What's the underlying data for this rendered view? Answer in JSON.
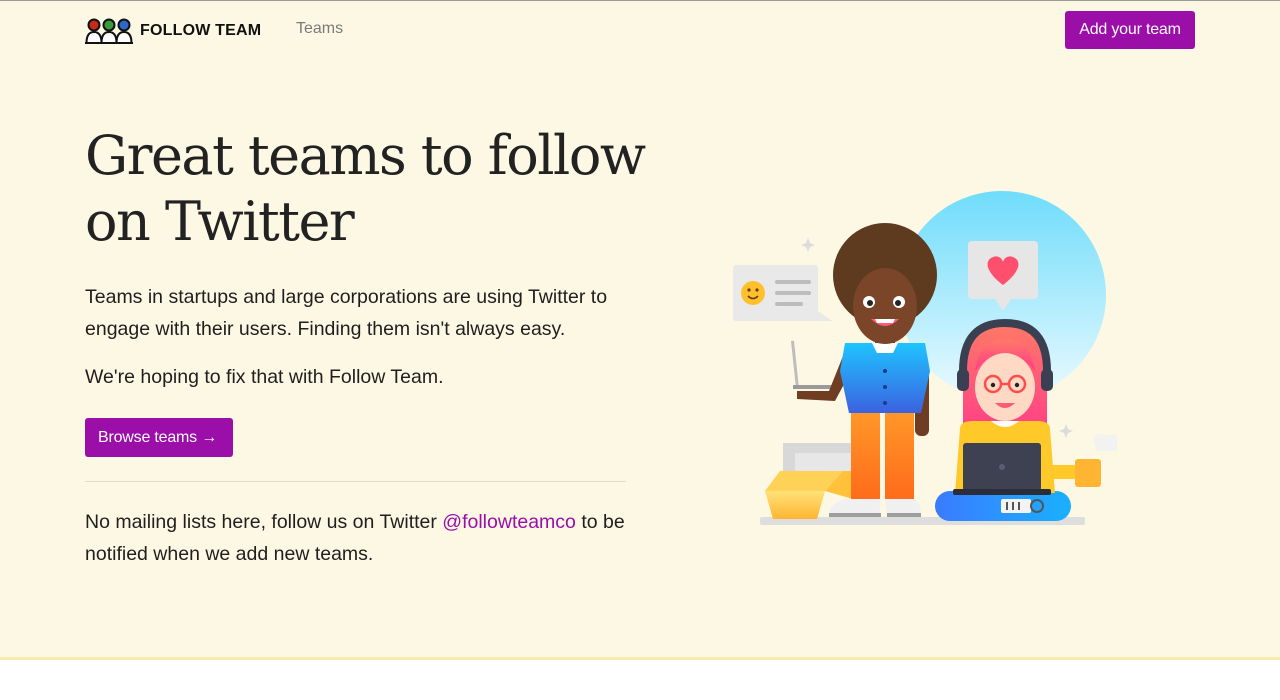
{
  "header": {
    "logo_text": "FOLLOW TEAM",
    "nav": [
      {
        "label": "Teams"
      }
    ],
    "cta_label": "Add your team"
  },
  "hero": {
    "title_line1": "Great teams to follow",
    "title_line2": "on Twitter",
    "lead": "Teams in startups and large corporations are using Twitter to engage with their users. Finding them isn't always easy.",
    "lead2": "We're hoping to fix that with Follow Team.",
    "browse_label": "Browse teams",
    "browse_arrow": "→"
  },
  "follow_note": {
    "before": "No mailing lists here, follow us on Twitter ",
    "handle": "@followteamco",
    "after": " to be notified when we add new teams."
  },
  "colors": {
    "accent": "#9b0ea8",
    "background": "#fdf8e4",
    "link": "#9b0ea8"
  },
  "icons": {
    "logo": "three-people-icon",
    "illustration": "team-working-illustration"
  }
}
